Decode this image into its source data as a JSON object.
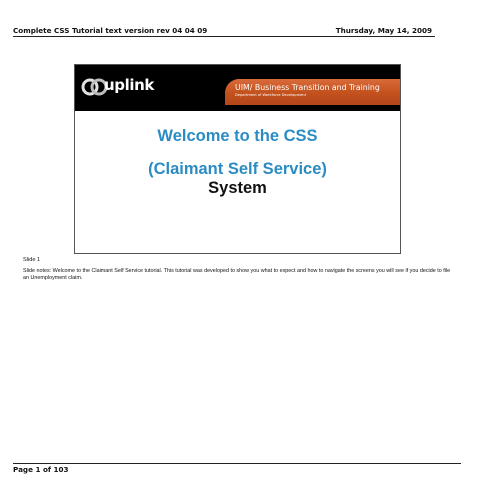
{
  "header": {
    "title": "Complete CSS Tutorial text version rev 04 04 09",
    "date": "Thursday, May 14, 2009"
  },
  "slide": {
    "logo_text": "uplink",
    "banner_heading": "UIM/ Business Transition and Training",
    "banner_subheading": "Department of Workforce Development",
    "welcome_line_1": "Welcome to the CSS",
    "welcome_line_2": "(Claimant Self Service)",
    "welcome_line_3": "System",
    "colors": {
      "banner_background": "#000000",
      "banner_stripe": "#c4531f",
      "welcome_blue": "#2b8cc4"
    }
  },
  "notes": {
    "slide_label": "Slide 1",
    "text": "Slide notes: Welcome to the Claimant Self Service tutorial.  This tutorial was developed to show you what to expect and how to navigate the screens you will see if you decide to file an Unemployment claim."
  },
  "footer": {
    "page_number": "Page 1 of 103"
  }
}
